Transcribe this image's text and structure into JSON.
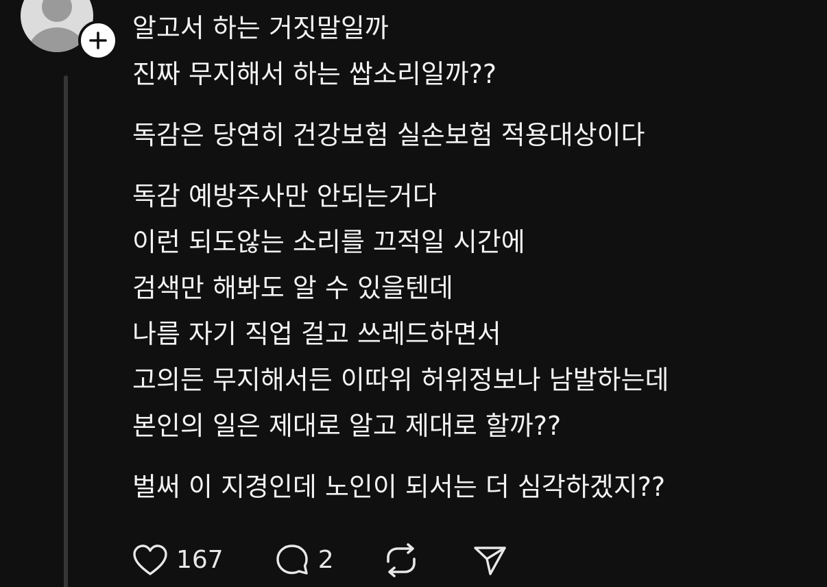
{
  "post": {
    "paragraphs": [
      {
        "lines": [
          "알고서 하는 거짓말일까",
          "진짜 무지해서 하는 쌉소리일까??"
        ]
      },
      {
        "lines": [
          "독감은 당연히 건강보험 실손보험 적용대상이다"
        ]
      },
      {
        "lines": [
          "독감 예방주사만 안되는거다",
          "이런 되도않는 소리를 끄적일 시간에",
          "검색만 해봐도 알 수 있을텐데",
          "나름 자기 직업 걸고 쓰레드하면서",
          "고의든 무지해서든 이따위 허위정보나 남발하는데",
          "본인의 일은 제대로 알고 제대로 할까??"
        ]
      },
      {
        "lines": [
          "벌써 이 지경인데 노인이 되서는 더 심각하겠지??"
        ]
      }
    ]
  },
  "actions": {
    "like_count": "167",
    "reply_count": "2"
  },
  "icons": {
    "avatar": "default-avatar-icon",
    "follow": "plus-icon",
    "like": "heart-icon",
    "reply": "comment-bubble-icon",
    "repost": "repost-arrows-icon",
    "share": "send-icon"
  },
  "colors": {
    "background": "#101010",
    "text": "#f3f3f3",
    "thread_line": "#363636"
  }
}
